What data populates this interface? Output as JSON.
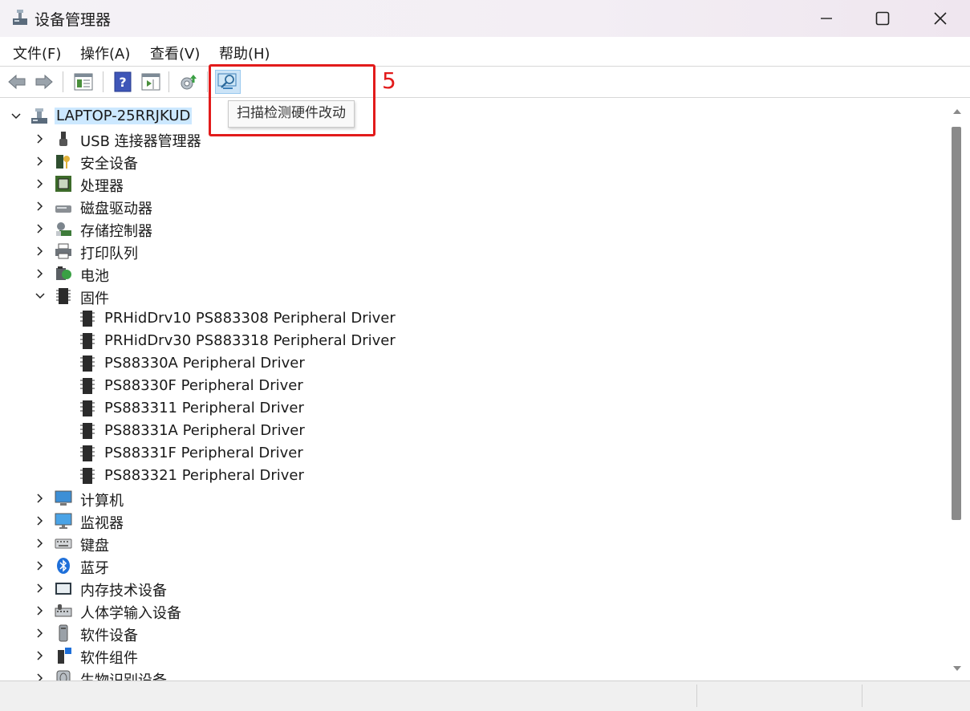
{
  "window": {
    "title": "设备管理器",
    "controls": {
      "minimize": "minimize",
      "maximize": "maximize",
      "close": "close"
    }
  },
  "menu": [
    "文件(F)",
    "操作(A)",
    "查看(V)",
    "帮助(H)"
  ],
  "toolbar": {
    "buttons": [
      "back-arrow",
      "forward-arrow",
      "properties",
      "help",
      "show-hide-console-tree",
      "update-driver",
      "scan-hardware-changes"
    ],
    "tooltip": "扫描检测硬件改动"
  },
  "annotation": {
    "step": "5",
    "color": "#e21b1b"
  },
  "tree": {
    "root": "LAPTOP-25RRJKUD",
    "categories_before": [
      {
        "label": "USB 连接器管理器",
        "icon": "usb-icon"
      },
      {
        "label": "安全设备",
        "icon": "security-device-icon"
      },
      {
        "label": "处理器",
        "icon": "processor-icon"
      },
      {
        "label": "磁盘驱动器",
        "icon": "disk-drive-icon"
      },
      {
        "label": "存储控制器",
        "icon": "storage-controller-icon"
      },
      {
        "label": "打印队列",
        "icon": "printer-icon"
      },
      {
        "label": "电池",
        "icon": "battery-icon"
      }
    ],
    "expanded": {
      "label": "固件",
      "icon": "firmware-icon",
      "children": [
        "PRHidDrv10 PS883308 Peripheral Driver",
        "PRHidDrv30 PS883318 Peripheral Driver",
        "PS88330A Peripheral Driver",
        "PS88330F Peripheral Driver",
        "PS883311 Peripheral Driver",
        "PS88331A Peripheral Driver",
        "PS88331F Peripheral Driver",
        "PS883321 Peripheral Driver"
      ]
    },
    "categories_after": [
      {
        "label": "计算机",
        "icon": "computer-icon"
      },
      {
        "label": "监视器",
        "icon": "monitor-icon"
      },
      {
        "label": "键盘",
        "icon": "keyboard-icon"
      },
      {
        "label": "蓝牙",
        "icon": "bluetooth-icon"
      },
      {
        "label": "内存技术设备",
        "icon": "memory-device-icon"
      },
      {
        "label": "人体学输入设备",
        "icon": "hid-icon"
      },
      {
        "label": "软件设备",
        "icon": "software-device-icon"
      },
      {
        "label": "软件组件",
        "icon": "software-component-icon"
      },
      {
        "label": "生物识别设备",
        "icon": "biometric-icon"
      }
    ]
  },
  "colors": {
    "selection": "#cce8ff",
    "accent": "#0078d4"
  }
}
